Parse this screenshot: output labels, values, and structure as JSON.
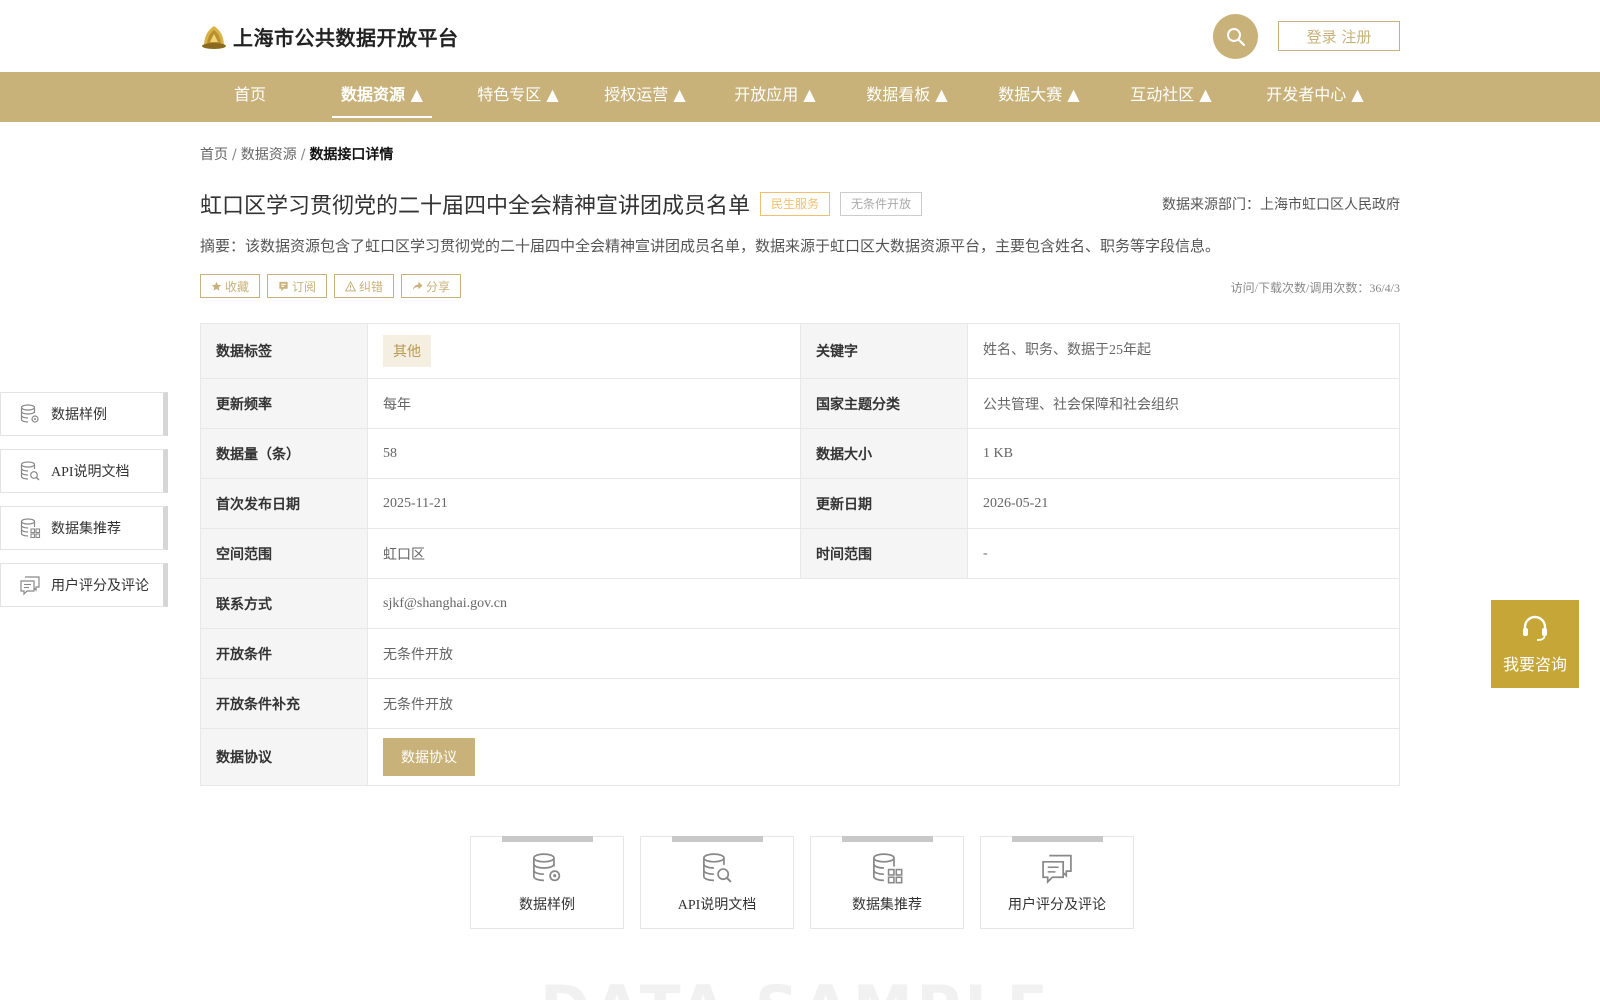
{
  "header": {
    "site_title": "上海市公共数据开放平台",
    "login_label": "登录 注册"
  },
  "nav": {
    "items": [
      {
        "label": "首页"
      },
      {
        "label": "数据资源 ▲"
      },
      {
        "label": "特色专区 ▲"
      },
      {
        "label": "授权运营 ▲"
      },
      {
        "label": "开放应用 ▲"
      },
      {
        "label": "数据看板 ▲"
      },
      {
        "label": "数据大赛 ▲"
      },
      {
        "label": "互动社区 ▲"
      },
      {
        "label": "开发者中心 ▲"
      }
    ],
    "active_index": 1
  },
  "breadcrumb": {
    "items": [
      "首页",
      "数据资源",
      "数据接口详情"
    ],
    "separator": "/"
  },
  "dataset": {
    "title": "虹口区学习贯彻党的二十届四中全会精神宣讲团成员名单",
    "tag_service": "民生服务",
    "tag_open": "无条件开放",
    "source_dept": "数据来源部门：上海市虹口区人民政府",
    "summary": "摘要：该数据资源包含了虹口区学习贯彻党的二十届四中全会精神宣讲团成员名单，数据来源于虹口区大数据资源平台，主要包含姓名、职务等字段信息。",
    "stats": "访问/下载次数/调用次数：36/4/3"
  },
  "actions": {
    "favorite": "收藏",
    "subscribe": "订阅",
    "report": "纠错",
    "share": "分享"
  },
  "table": {
    "tag_label": "数据标签",
    "tag_value": "其他",
    "keyword_label": "关键字",
    "keyword_value": "姓名、职务、数据于25年起",
    "freq_label": "更新频率",
    "freq_value": "每年",
    "theme_label": "国家主题分类",
    "theme_value": "公共管理、社会保障和社会组织",
    "count_label": "数据量（条）",
    "count_value": "58",
    "size_label": "数据大小",
    "size_value": "1 KB",
    "first_pub_label": "首次发布日期",
    "first_pub_value": "2025-11-21",
    "update_label": "更新日期",
    "update_value": "2026-05-21",
    "space_label": "空间范围",
    "space_value": "虹口区",
    "time_label": "时间范围",
    "time_value": "-",
    "contact_label": "联系方式",
    "contact_value": "sjkf@shanghai.gov.cn",
    "open_cond_label": "开放条件",
    "open_cond_value": "无条件开放",
    "open_cond_sup_label": "开放条件补充",
    "open_cond_sup_value": "无条件开放",
    "agreement_label": "数据协议",
    "agreement_button": "数据协议"
  },
  "side_nav": {
    "items": [
      {
        "label": "数据样例",
        "icon": "database-gear-icon"
      },
      {
        "label": "API说明文档",
        "icon": "database-search-icon"
      },
      {
        "label": "数据集推荐",
        "icon": "database-grid-icon"
      },
      {
        "label": "用户评分及评论",
        "icon": "comment-icon"
      }
    ]
  },
  "consult": {
    "label": "我要咨询",
    "icon": "headset-icon"
  },
  "cards": [
    {
      "label": "数据样例",
      "icon": "database-gear-icon"
    },
    {
      "label": "API说明文档",
      "icon": "database-search-icon"
    },
    {
      "label": "数据集推荐",
      "icon": "database-grid-icon"
    },
    {
      "label": "用户评分及评论",
      "icon": "comment-icon"
    }
  ],
  "watermark": "DATA SAMPLE",
  "colors": {
    "brand": "#c9b27a",
    "consult": "#c5a636",
    "tag_service": "#f0c070"
  }
}
